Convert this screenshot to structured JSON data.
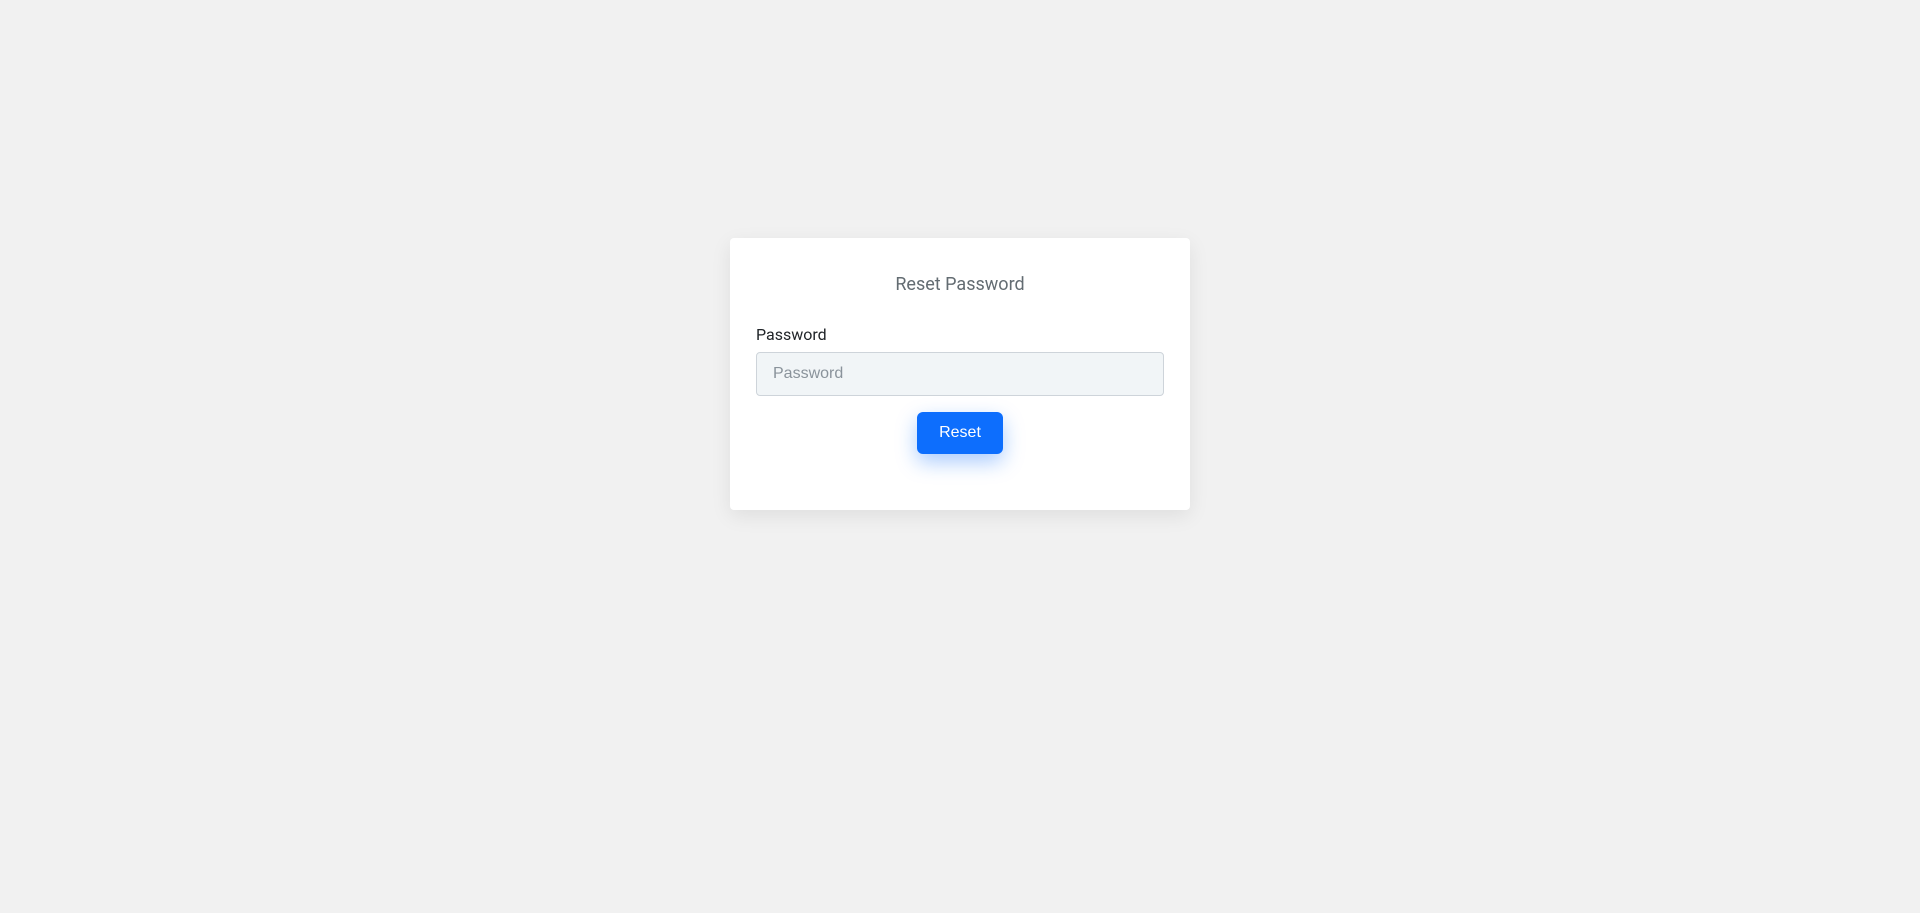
{
  "card": {
    "title": "Reset Password"
  },
  "form": {
    "password_label": "Password",
    "password_placeholder": "Password",
    "password_value": "",
    "submit_label": "Reset"
  },
  "colors": {
    "page_bg": "#f1f1f1",
    "card_bg": "#ffffff",
    "title_color": "#636c72",
    "input_bg": "#f1f5f7",
    "input_border": "#ced4da",
    "button_bg": "#0d6efd",
    "button_text": "#ffffff"
  }
}
